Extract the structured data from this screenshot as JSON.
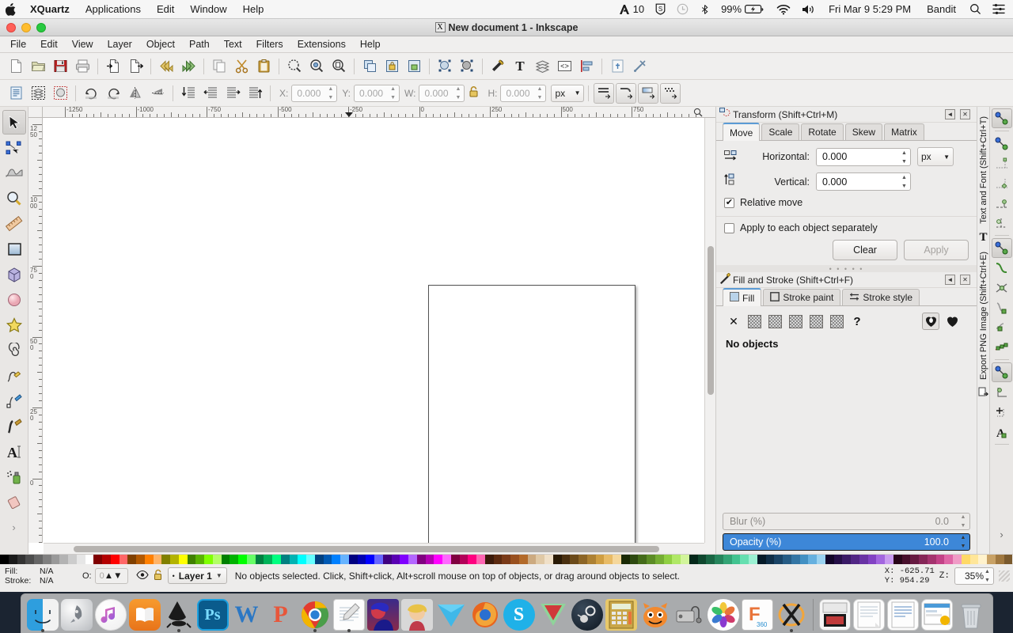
{
  "macbar": {
    "apple_icon": "apple-logo",
    "app_name": "XQuartz",
    "menus": [
      "Applications",
      "Edit",
      "Window",
      "Help"
    ],
    "status_items": [
      {
        "name": "adobe-cc-icon",
        "label": "10"
      },
      {
        "name": "shield-s-icon",
        "label": ""
      },
      {
        "name": "clock-icon",
        "label": ""
      },
      {
        "name": "bluetooth-icon",
        "label": ""
      },
      {
        "name": "battery-icon",
        "label": "99%"
      },
      {
        "name": "wifi-icon",
        "label": ""
      },
      {
        "name": "volume-icon",
        "label": ""
      }
    ],
    "datetime": "Fri Mar 9  5:29 PM",
    "user": "Bandit",
    "search_icon": "search-icon",
    "control_center_icon": "control-center-icon"
  },
  "window": {
    "title": "New document 1 - Inkscape",
    "xquartz_badge": "X"
  },
  "menubar": [
    "File",
    "Edit",
    "View",
    "Layer",
    "Object",
    "Path",
    "Text",
    "Filters",
    "Extensions",
    "Help"
  ],
  "commands_toolbar": [
    {
      "name": "new-document-button",
      "icon": "new-document-icon"
    },
    {
      "name": "open-document-button",
      "icon": "open-folder-icon"
    },
    {
      "name": "save-document-button",
      "icon": "save-floppy-icon"
    },
    {
      "name": "print-document-button",
      "icon": "printer-icon"
    },
    {
      "name": "import-button",
      "icon": "import-icon"
    },
    {
      "name": "export-button",
      "icon": "export-icon"
    },
    {
      "name": "undo-button",
      "icon": "undo-arrow-icon"
    },
    {
      "name": "redo-button",
      "icon": "redo-arrow-icon"
    },
    {
      "name": "copy-button",
      "icon": "copy-icon"
    },
    {
      "name": "cut-button",
      "icon": "scissors-icon"
    },
    {
      "name": "paste-button",
      "icon": "clipboard-icon"
    },
    {
      "name": "zoom-selection-button",
      "icon": "zoom-selection-icon"
    },
    {
      "name": "zoom-drawing-button",
      "icon": "zoom-drawing-icon"
    },
    {
      "name": "zoom-page-button",
      "icon": "zoom-page-icon"
    },
    {
      "name": "duplicate-button",
      "icon": "duplicate-icon"
    },
    {
      "name": "group-button",
      "icon": "group-icon"
    },
    {
      "name": "ungroup-button",
      "icon": "ungroup-icon"
    },
    {
      "name": "clip-button",
      "icon": "clip-object-icon"
    },
    {
      "name": "mask-button",
      "icon": "mask-object-icon"
    },
    {
      "name": "fill-stroke-dialog-button",
      "icon": "fill-stroke-icon"
    },
    {
      "name": "text-font-dialog-button",
      "icon": "text-tool-icon"
    },
    {
      "name": "layers-dialog-button",
      "icon": "layers-icon"
    },
    {
      "name": "xml-editor-button",
      "icon": "xml-editor-icon"
    },
    {
      "name": "align-distribute-button",
      "icon": "align-icon"
    },
    {
      "name": "document-properties-button",
      "icon": "document-properties-icon"
    },
    {
      "name": "preferences-button",
      "icon": "preferences-tools-icon"
    }
  ],
  "tool_controls": {
    "buttons": [
      {
        "name": "select-all-button",
        "icon": "select-all-icon"
      },
      {
        "name": "select-all-layers-button",
        "icon": "select-all-layers-icon"
      },
      {
        "name": "deselect-button",
        "icon": "deselect-icon"
      },
      {
        "name": "rotate-ccw-button",
        "icon": "rotate-ccw-icon"
      },
      {
        "name": "rotate-cw-button",
        "icon": "rotate-cw-icon"
      },
      {
        "name": "flip-horizontal-button",
        "icon": "flip-horizontal-icon"
      },
      {
        "name": "flip-vertical-button",
        "icon": "flip-vertical-icon"
      },
      {
        "name": "lower-to-bottom-button",
        "icon": "lower-to-bottom-icon"
      },
      {
        "name": "lower-button",
        "icon": "lower-icon"
      },
      {
        "name": "raise-button",
        "icon": "raise-icon"
      },
      {
        "name": "raise-to-top-button",
        "icon": "raise-to-top-icon"
      }
    ],
    "x_label": "X:",
    "x_value": "0.000",
    "y_label": "Y:",
    "y_value": "0.000",
    "w_label": "W:",
    "w_value": "0.000",
    "lock_icon": "lock-ratio-icon",
    "h_label": "H:",
    "h_value": "0.000",
    "units": "px",
    "affect_buttons": [
      {
        "name": "affect-stroke-width-button",
        "icon": "scale-stroke-icon"
      },
      {
        "name": "affect-rounded-corners-button",
        "icon": "scale-corners-icon"
      },
      {
        "name": "affect-gradients-button",
        "icon": "scale-gradients-icon"
      },
      {
        "name": "affect-patterns-button",
        "icon": "scale-patterns-icon"
      }
    ]
  },
  "toolbox": [
    {
      "name": "tool-selector",
      "icon": "arrow-cursor-icon",
      "selected": true
    },
    {
      "name": "tool-node-editor",
      "icon": "node-editor-icon",
      "selected": false
    },
    {
      "name": "tool-tweak",
      "icon": "tweak-icon",
      "selected": false
    },
    {
      "name": "tool-zoom",
      "icon": "magnifier-icon",
      "selected": false
    },
    {
      "name": "tool-measure",
      "icon": "ruler-icon",
      "selected": false
    },
    {
      "name": "tool-rectangle",
      "icon": "rectangle-icon",
      "selected": false
    },
    {
      "name": "tool-3dbox",
      "icon": "cube-icon",
      "selected": false
    },
    {
      "name": "tool-ellipse",
      "icon": "circle-icon",
      "selected": false
    },
    {
      "name": "tool-star",
      "icon": "star-icon",
      "selected": false
    },
    {
      "name": "tool-spiral",
      "icon": "spiral-icon",
      "selected": false
    },
    {
      "name": "tool-pencil",
      "icon": "pencil-icon",
      "selected": false
    },
    {
      "name": "tool-bezier",
      "icon": "bezier-pen-icon",
      "selected": false
    },
    {
      "name": "tool-calligraphy",
      "icon": "calligraphy-pen-icon",
      "selected": false
    },
    {
      "name": "tool-text",
      "icon": "text-a-icon",
      "selected": false
    },
    {
      "name": "tool-spray",
      "icon": "spray-can-icon",
      "selected": false
    },
    {
      "name": "tool-eraser",
      "icon": "eraser-icon",
      "selected": false
    },
    {
      "name": "toolbox-overflow",
      "icon": "chevron-right-icon",
      "selected": false
    }
  ],
  "rulers": {
    "horizontal_labels": [
      "-1250",
      "-1000",
      "-750",
      "-500",
      "-250",
      "0",
      "250",
      "500",
      "750"
    ],
    "vertical_labels": [
      "1250",
      "1000",
      "750",
      "500",
      "250",
      "0"
    ]
  },
  "transform_dialog": {
    "title": "Transform (Shift+Ctrl+M)",
    "icon": "transform-icon",
    "collapse_icon": "collapse-icon",
    "close_icon": "close-icon",
    "tabs": [
      "Move",
      "Scale",
      "Rotate",
      "Skew",
      "Matrix"
    ],
    "active_tab": "Move",
    "horizontal_label": "Horizontal:",
    "horizontal_value": "0.000",
    "horizontal_icon": "move-horizontal-icon",
    "vertical_label": "Vertical:",
    "vertical_value": "0.000",
    "vertical_icon": "move-vertical-icon",
    "units": "px",
    "relative_move_label": "Relative move",
    "relative_move_checked": true,
    "apply_each_label": "Apply to each object separately",
    "apply_each_checked": false,
    "clear_button": "Clear",
    "apply_button": "Apply",
    "apply_disabled": true
  },
  "fill_stroke_dialog": {
    "title": "Fill and Stroke (Shift+Ctrl+F)",
    "icon": "fill-stroke-icon",
    "collapse_icon": "collapse-icon",
    "close_icon": "close-icon",
    "tabs": [
      {
        "label": "Fill",
        "icon": "fill-swatch-icon"
      },
      {
        "label": "Stroke paint",
        "icon": "stroke-paint-icon"
      },
      {
        "label": "Stroke style",
        "icon": "stroke-style-icon"
      }
    ],
    "active_tab": "Fill",
    "paint_buttons": [
      {
        "name": "fill-none-button",
        "icon": "x-no-paint-icon"
      },
      {
        "name": "fill-flat-color-button",
        "icon": "flat-color-icon"
      },
      {
        "name": "fill-linear-gradient-button",
        "icon": "linear-gradient-icon"
      },
      {
        "name": "fill-radial-gradient-button",
        "icon": "radial-gradient-icon"
      },
      {
        "name": "fill-pattern-button",
        "icon": "pattern-icon"
      },
      {
        "name": "fill-swatch-button",
        "icon": "swatch-icon"
      },
      {
        "name": "fill-unknown-button",
        "icon": "question-mark-icon"
      }
    ],
    "fillrule_buttons": [
      {
        "name": "fillrule-evenodd-button",
        "icon": "fill-rule-evenodd-icon",
        "active": true
      },
      {
        "name": "fillrule-nonzero-button",
        "icon": "fill-rule-nonzero-icon",
        "active": false
      }
    ],
    "no_objects_text": "No objects",
    "blur_label": "Blur (%)",
    "blur_value": "0.0",
    "opacity_label": "Opacity (%)",
    "opacity_value": "100.0"
  },
  "side_tabs": [
    {
      "label": "Text and Font (Shift+Ctrl+T)",
      "icon": "text-tool-icon"
    },
    {
      "label": "Export PNG Image (Shift+Ctrl+E)",
      "icon": "export-png-icon"
    }
  ],
  "snap_toolbar": [
    {
      "name": "snap-enable-button",
      "icon": "snap-global-icon",
      "on": true
    },
    {
      "name": "snap-bounding-box-button",
      "icon": "snap-bbox-icon",
      "on": false
    },
    {
      "name": "snap-bbox-edges-button",
      "icon": "snap-bbox-edges-icon",
      "on": false
    },
    {
      "name": "snap-bbox-corners-button",
      "icon": "snap-bbox-corners-icon",
      "on": false
    },
    {
      "name": "snap-bbox-edge-midpoints-button",
      "icon": "snap-edge-midpoint-icon",
      "on": false
    },
    {
      "name": "snap-bbox-centers-button",
      "icon": "snap-bbox-center-icon",
      "on": false
    },
    {
      "name": "snap-nodes-button",
      "icon": "snap-nodes-icon",
      "on": true
    },
    {
      "name": "snap-paths-button",
      "icon": "snap-path-icon",
      "on": false
    },
    {
      "name": "snap-path-intersections-button",
      "icon": "snap-intersection-icon",
      "on": false
    },
    {
      "name": "snap-cusp-nodes-button",
      "icon": "snap-cusp-node-icon",
      "on": false
    },
    {
      "name": "snap-smooth-nodes-button",
      "icon": "snap-smooth-node-icon",
      "on": false
    },
    {
      "name": "snap-line-midpoints-button",
      "icon": "snap-line-midpoint-icon",
      "on": false
    },
    {
      "name": "snap-others-button",
      "icon": "snap-others-icon",
      "on": true
    },
    {
      "name": "snap-object-centers-button",
      "icon": "snap-object-center-icon",
      "on": false
    },
    {
      "name": "snap-rotation-centers-button",
      "icon": "snap-rotation-center-icon",
      "on": false
    },
    {
      "name": "snap-text-baseline-button",
      "icon": "snap-text-baseline-icon",
      "on": false
    },
    {
      "name": "snap-overflow-button",
      "icon": "chevron-right-icon",
      "on": false
    }
  ],
  "statusbar": {
    "fill_label": "Fill:",
    "fill_value": "N/A",
    "stroke_label": "Stroke:",
    "stroke_value": "N/A",
    "opacity_label": "O:",
    "opacity_value": "0",
    "layer_visibility_icon": "eye-icon",
    "layer_lock_icon": "unlock-icon",
    "layer_name": "Layer 1",
    "layer_dropdown_icon": "chevron-down-icon",
    "message": "No objects selected. Click, Shift+click, Alt+scroll mouse on top of objects, or drag around objects to select.",
    "x_label": "X:",
    "x_value": "-625.71",
    "y_label": "Y:",
    "y_value": "954.29",
    "z_label": "Z:",
    "zoom_value": "35%"
  },
  "dock": {
    "items": [
      {
        "name": "dock-finder",
        "label": "Finder",
        "running": true
      },
      {
        "name": "dock-launchpad",
        "label": "Launchpad",
        "running": false
      },
      {
        "name": "dock-itunes",
        "label": "iTunes",
        "running": false
      },
      {
        "name": "dock-ibooks",
        "label": "iBooks",
        "running": false
      },
      {
        "name": "dock-inkscape",
        "label": "Inkscape",
        "running": true
      },
      {
        "name": "dock-photoshop",
        "label": "Photoshop",
        "running": false
      },
      {
        "name": "dock-word",
        "label": "Word",
        "running": false
      },
      {
        "name": "dock-powerpoint",
        "label": "PowerPoint",
        "running": false
      },
      {
        "name": "dock-chrome",
        "label": "Chrome",
        "running": true
      },
      {
        "name": "dock-textedit",
        "label": "TextEdit",
        "running": true
      },
      {
        "name": "dock-art-blue",
        "label": "Art",
        "running": false
      },
      {
        "name": "dock-art-anime",
        "label": "Anime",
        "running": false
      },
      {
        "name": "dock-vector",
        "label": "Vector App",
        "running": false
      },
      {
        "name": "dock-firefox",
        "label": "Firefox",
        "running": false
      },
      {
        "name": "dock-skype",
        "label": "Skype",
        "running": false
      },
      {
        "name": "dock-vivaldi",
        "label": "Vivaldi",
        "running": false
      },
      {
        "name": "dock-steam",
        "label": "Steam",
        "running": false
      },
      {
        "name": "dock-calculator",
        "label": "Calculator",
        "running": false
      },
      {
        "name": "dock-scratch",
        "label": "Scratch",
        "running": false
      },
      {
        "name": "dock-server",
        "label": "Server Monitor",
        "running": false
      },
      {
        "name": "dock-photos",
        "label": "Photos",
        "running": false
      },
      {
        "name": "dock-fusion360",
        "label": "Fusion 360",
        "running": false
      },
      {
        "name": "dock-xquartz",
        "label": "XQuartz",
        "running": true
      }
    ],
    "stacks": [
      {
        "name": "dock-stack-images",
        "label": "Images"
      },
      {
        "name": "dock-stack-documents",
        "label": "Documents"
      },
      {
        "name": "dock-stack-documents2",
        "label": "Documents"
      },
      {
        "name": "dock-stack-downloads",
        "label": "Downloads"
      },
      {
        "name": "dock-trash",
        "label": "Trash"
      }
    ]
  },
  "palette_colors": [
    "#000000",
    "#1a1a1a",
    "#333333",
    "#4d4d4d",
    "#666666",
    "#808080",
    "#999999",
    "#b3b3b3",
    "#cccccc",
    "#e6e6e6",
    "#ffffff",
    "#800000",
    "#b30000",
    "#ff0000",
    "#ff6666",
    "#804000",
    "#b35900",
    "#ff8000",
    "#ffb366",
    "#808000",
    "#b3b300",
    "#ffff00",
    "#408000",
    "#59b300",
    "#80ff00",
    "#b3ff66",
    "#008000",
    "#00b300",
    "#00ff00",
    "#66ff66",
    "#008040",
    "#00b359",
    "#00ff80",
    "#008080",
    "#00b3b3",
    "#00ffff",
    "#66ffff",
    "#004080",
    "#0059b3",
    "#0080ff",
    "#66b3ff",
    "#000080",
    "#0000b3",
    "#0000ff",
    "#6666ff",
    "#400080",
    "#5900b3",
    "#8000ff",
    "#b366ff",
    "#800080",
    "#b300b3",
    "#ff00ff",
    "#ff66ff",
    "#800040",
    "#b30059",
    "#ff0080",
    "#ff66b3",
    "#3c1a0a",
    "#5c2a10",
    "#7a3a18",
    "#99501f",
    "#b36a2a",
    "#ccaa80",
    "#e0c9a6",
    "#f0e0c8",
    "#2a1a05",
    "#4a3010",
    "#6b4a1a",
    "#8c6526",
    "#ad8133",
    "#cf9e42",
    "#e8bb66",
    "#f5d79b",
    "#1a2a05",
    "#2e4a10",
    "#446b1a",
    "#5c8c26",
    "#75ad33",
    "#90cf42",
    "#b0e866",
    "#d2f59b",
    "#05281a",
    "#0f472e",
    "#1a6644",
    "#26855c",
    "#33a475",
    "#42c390",
    "#66dfb0",
    "#9bf0d2",
    "#051a28",
    "#0f2e47",
    "#1a4466",
    "#265c85",
    "#3375a4",
    "#4290c3",
    "#66b0df",
    "#9bd2f0",
    "#120528",
    "#250f47",
    "#3a1a66",
    "#512685",
    "#6933a4",
    "#8242c3",
    "#a366df",
    "#c99bf0",
    "#280519",
    "#470f2c",
    "#661a41",
    "#852657",
    "#a4336e",
    "#c34287",
    "#df66a6",
    "#f09bc6",
    "#ffd966",
    "#ffe699",
    "#fff2cc",
    "#c8a165",
    "#a07840",
    "#7a5a2e"
  ]
}
